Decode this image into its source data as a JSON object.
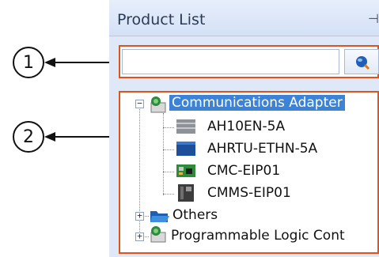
{
  "callouts": [
    "1",
    "2"
  ],
  "panel": {
    "title": "Product List",
    "pin_glyph": "⊣"
  },
  "search": {
    "value": "",
    "placeholder": "",
    "button_icon": "search-globe-icon"
  },
  "tree": {
    "nodes": [
      {
        "label": "Communications Adapter",
        "expanded": true,
        "selected": true,
        "icon": "network-folder-icon",
        "children": [
          {
            "label": "AH10EN-5A",
            "icon": "device-gray-icon"
          },
          {
            "label": "AHRTU-ETHN-5A",
            "icon": "device-blue-icon"
          },
          {
            "label": "CMC-EIP01",
            "icon": "circuit-board-icon"
          },
          {
            "label": "CMMS-EIP01",
            "icon": "device-dark-icon"
          }
        ]
      },
      {
        "label": "Others",
        "expanded": false,
        "icon": "blue-folder-icon"
      },
      {
        "label": "Programmable Logic Cont",
        "expanded": false,
        "icon": "network-folder-icon"
      }
    ]
  },
  "colors": {
    "highlight": "#e0531d",
    "selection": "#3c83d8",
    "header": "#d4e1f6"
  }
}
